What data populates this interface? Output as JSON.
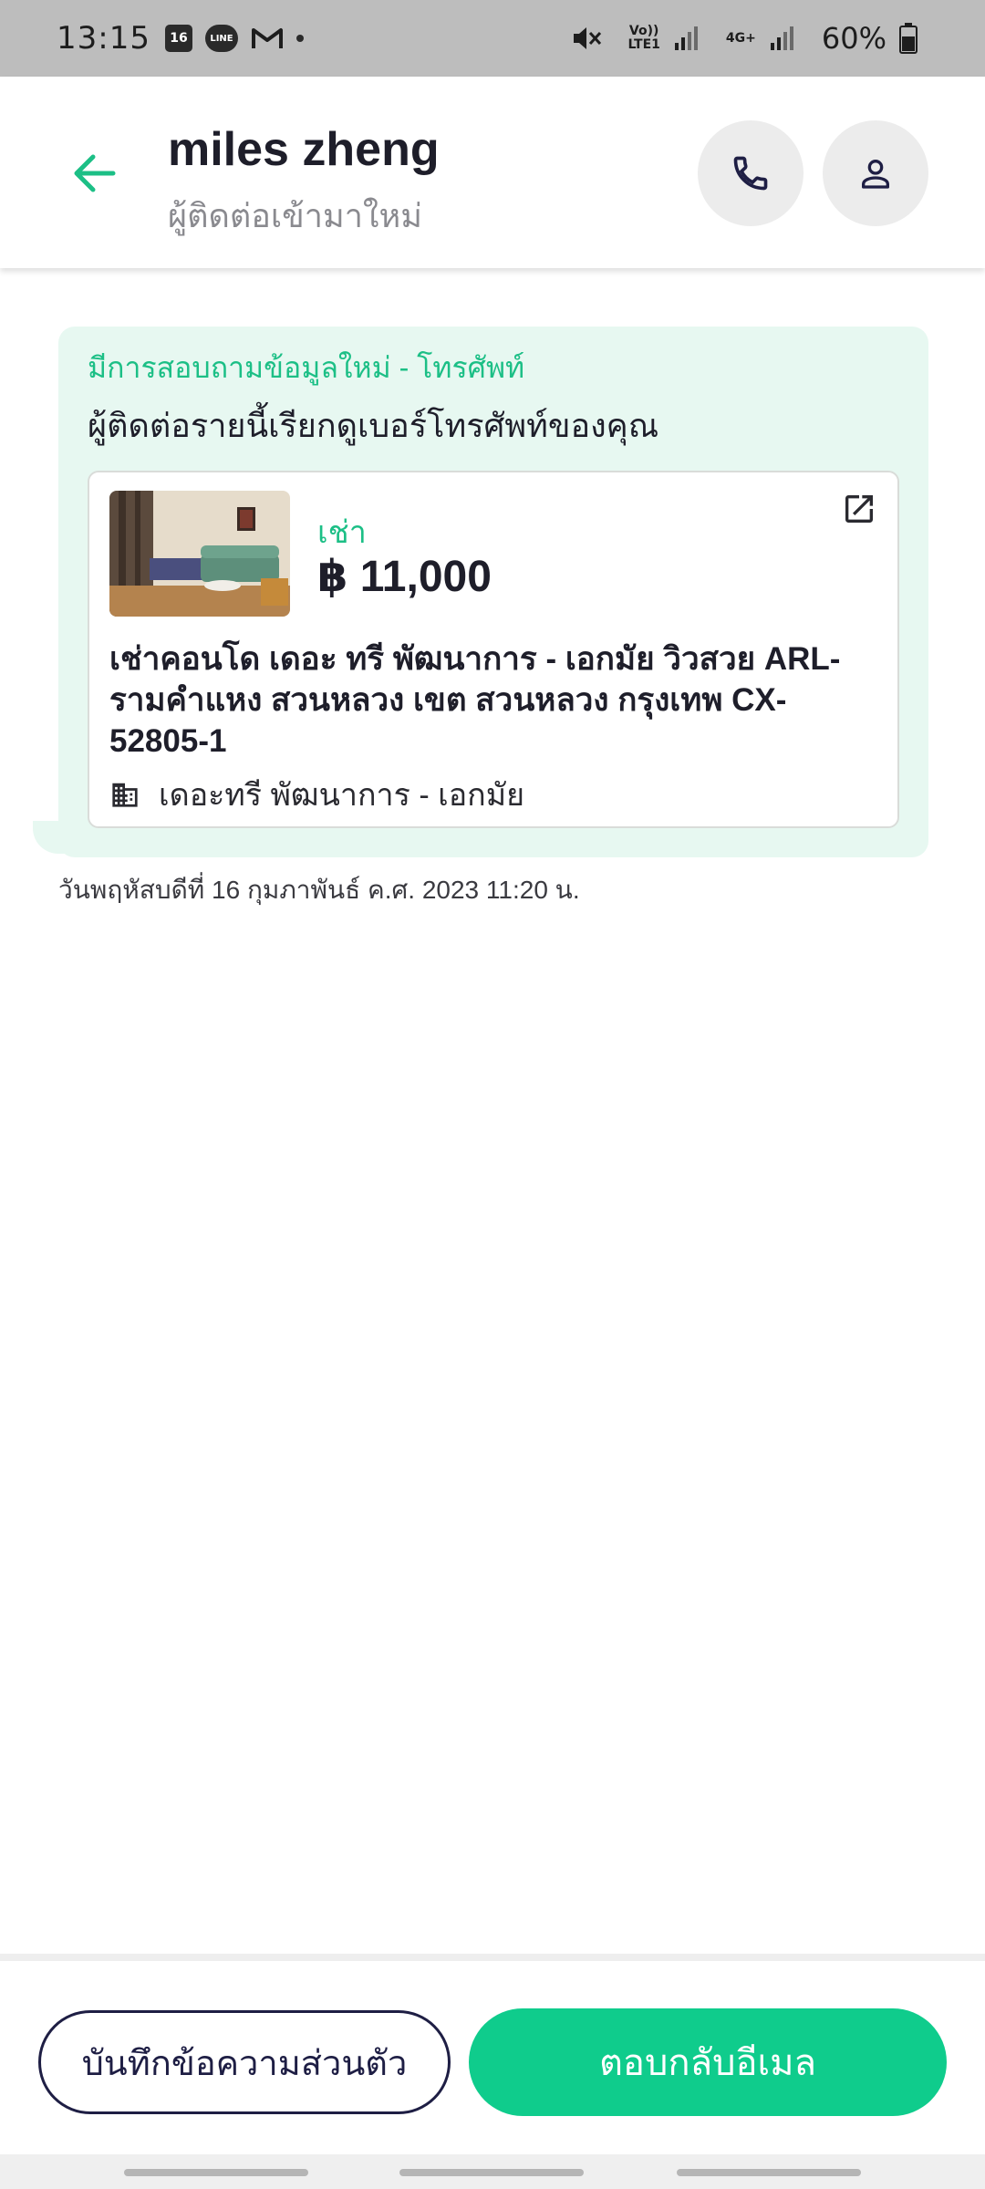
{
  "status_bar": {
    "time": "13:15",
    "calendar_day": "16",
    "line_label": "LINE",
    "volte_label": "Vo))\nLTE1",
    "net_label": "4G+",
    "battery": "60%"
  },
  "header": {
    "name": "miles zheng",
    "subtitle": "ผู้ติดต่อเข้ามาใหม่"
  },
  "message": {
    "title": "มีการสอบถามข้อมูลใหม่ - โทรศัพท์",
    "text": "ผู้ติดต่อรายนี้เรียกดูเบอร์โทรศัพท์ของคุณ",
    "timestamp": "วันพฤหัสบดีที่ 16 กุมภาพันธ์ ค.ศ. 2023 11:20 น."
  },
  "listing": {
    "type": "เช่า",
    "price": "฿ 11,000",
    "title": "เช่าคอนโด  เดอะ ทรี พัฒนาการ - เอกมัย วิวสวย ARL-รามคำแหง สวนหลวง เขต สวนหลวง กรุงเทพ CX-52805-1",
    "project": "เดอะทรี พัฒนาการ - เอกมัย"
  },
  "footer": {
    "note_button": "บันทึกข้อความส่วนตัว",
    "reply_button": "ตอบกลับอีเมล"
  },
  "colors": {
    "accent": "#0fcc8c",
    "accent_text": "#1cbf86",
    "bubble_bg": "#e7f8f1",
    "dark_navy": "#1e1e44"
  },
  "icons": {
    "back": "arrow-left-icon",
    "phone": "phone-icon",
    "profile": "person-icon",
    "open": "open-external-icon",
    "building": "building-icon"
  }
}
